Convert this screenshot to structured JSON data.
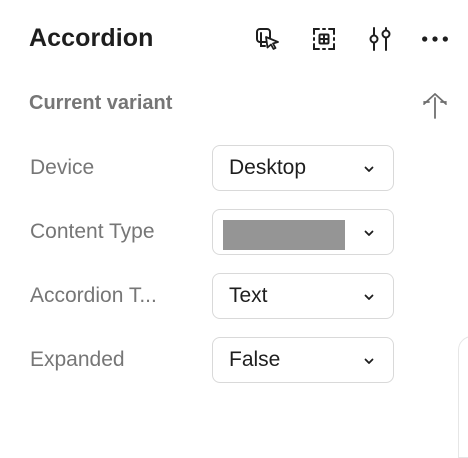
{
  "panel": {
    "title": "Accordion",
    "header_icons": [
      "cursor-select-icon",
      "component-grid-icon",
      "adjust-sliders-icon",
      "more-icon"
    ]
  },
  "variant": {
    "section_title": "Current variant",
    "action_icon": "upload-icon"
  },
  "properties": [
    {
      "label": "Device",
      "value": "Desktop",
      "swatch": false
    },
    {
      "label": "Content Type",
      "value": "",
      "swatch": true,
      "swatch_color": "#959595"
    },
    {
      "label": "Accordion T...",
      "value": "Text",
      "swatch": false
    },
    {
      "label": "Expanded",
      "value": "False",
      "swatch": false
    }
  ]
}
